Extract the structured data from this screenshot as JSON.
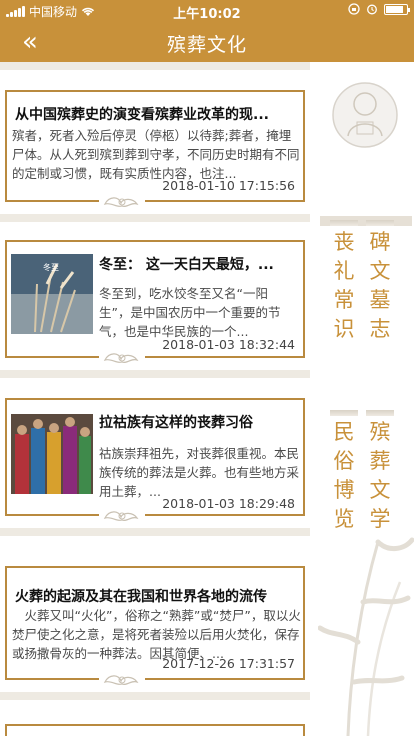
{
  "status": {
    "carrier": "中国移动",
    "time": "上午10:02",
    "battery_level": 0.85
  },
  "nav": {
    "back_glyph": "«",
    "title": "殡葬文化"
  },
  "articles": [
    {
      "title": "从中国殡葬史的演变看殡葬业改革的现...",
      "body": "殡者，死者入殓后停灵（停柩）以待葬;葬者，掩埋尸体。从人死到殡到葬到守孝，不同历史时期有不同的定制或习惯，既有实质性内容，也注...",
      "time": "2018-01-10 17:15:56",
      "has_image": false
    },
    {
      "title": "冬至： 这一天白天最短，...",
      "body": "冬至到，吃水饺冬至又名“一阳生”，是中国农历中一个重要的节气，也是中华民族的一个...",
      "time": "2018-01-03 18:32:44",
      "has_image": true,
      "image_caption": "冬至"
    },
    {
      "title": "拉祜族有这样的丧葬习俗",
      "body": "祜族崇拜祖先，对丧葬很重视。本民族传统的葬法是火葬。也有些地方采用土葬，...",
      "time": "2018-01-03 18:29:48",
      "has_image": true
    },
    {
      "title": "火葬的起源及其在我国和世界各地的流传",
      "body": "　火葬又叫“火化”，俗称之“熟葬”或“焚尸”，取以火焚尸使之化之意，是将死者装殓以后用火焚化，保存或扬撒骨灰的一种葬法。因其简便、...",
      "time": "2017-12-26 17:31:57",
      "has_image": false
    }
  ],
  "side_menu": [
    {
      "label": "碑文墓志"
    },
    {
      "label": "丧礼常识"
    },
    {
      "label": "殡葬文学"
    },
    {
      "label": "民俗博览"
    }
  ],
  "colors": {
    "accent": "#c8913a",
    "card_border": "#b98a3f"
  }
}
